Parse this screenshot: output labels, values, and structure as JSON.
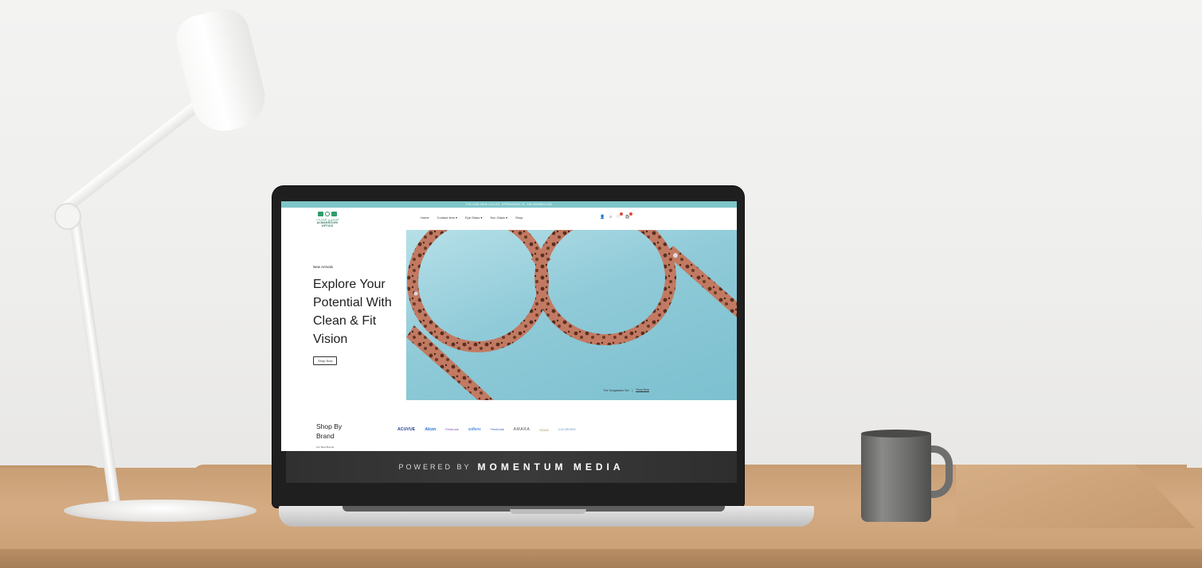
{
  "site": {
    "announcement": "FOLLOW NEW COLOR. SPREADING 25. 360 MOMENTUM",
    "logo": {
      "arabic": "المنصوري للبصريات",
      "name": "ALMANSOORI OPTICS"
    },
    "nav": [
      {
        "label": "Home"
      },
      {
        "label": "Contact lens ▾"
      },
      {
        "label": "Eye Glass ▾"
      },
      {
        "label": "Sun Glass ▾"
      },
      {
        "label": "Shop"
      }
    ],
    "header_icons": [
      {
        "name": "user-icon",
        "glyph": "👤"
      },
      {
        "name": "search-icon",
        "glyph": "⌕"
      },
      {
        "name": "wishlist-icon",
        "glyph": "♡"
      },
      {
        "name": "cart-icon",
        "glyph": "🛍"
      }
    ],
    "hero": {
      "eyebrow": "New Arrivals",
      "title": "Explore Your Potential With Clean & Fit Vision",
      "button": "Shop Now",
      "caption": "The Sunglasses Set",
      "caption_link": "Shop Now"
    },
    "brands": {
      "title": "Shop By Brand",
      "subtitle": "Our Best Brands",
      "items": [
        "ACUVUE",
        "Alcon",
        "FreshLook",
        "soflens",
        "FreshLook",
        "AMARA",
        "GOLD",
        "COLORVIEW"
      ]
    }
  },
  "banner": {
    "powered": "POWERED BY",
    "brand": "MOMENTUM MEDIA"
  },
  "colors": {
    "announcement_bg": "#7ec6c9",
    "hero_bg": "#8fcad8",
    "logo_green": "#2f9d6b",
    "frame_tortoise": "#b86b55"
  }
}
